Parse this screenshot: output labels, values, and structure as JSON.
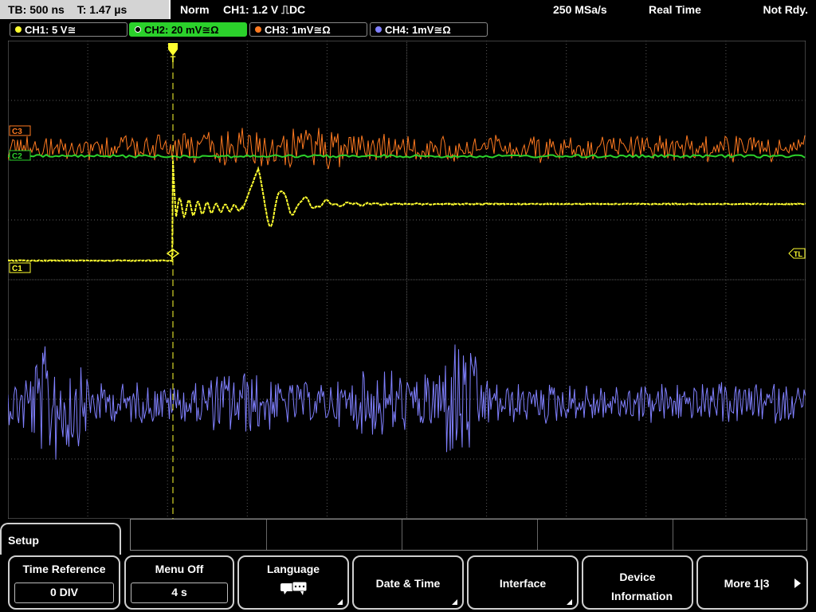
{
  "topbar": {
    "timebase": "TB: 500 ns",
    "trigger_time": "T: 1.47 µs",
    "trigger_mode": "Norm",
    "trigger_info": "CH1: 1.2 V ⎍DC",
    "sample_rate": "250 MSa/s",
    "acq_mode": "Real Time",
    "status": "Not Rdy."
  },
  "channels": [
    {
      "label": "CH1: 5 V≅",
      "color": "#ffff30"
    },
    {
      "label": "CH2: 20 mV≅Ω",
      "color": "#2bd12b"
    },
    {
      "label": "CH3: 1mV≅Ω",
      "color": "#ff7a20"
    },
    {
      "label": "CH4: 1mV≅Ω",
      "color": "#8080ff"
    }
  ],
  "markers": {
    "c1": "C1",
    "c3": "C3",
    "c2": "C2",
    "trigger_level": "TL",
    "trigger_pos": "T"
  },
  "colors": {
    "grid": "#5a5a5a",
    "ch1": "#ffff30",
    "ch2": "#2bd12b",
    "ch3": "#ff7a20",
    "ch4": "#8080ff"
  },
  "menu": {
    "title": "Setup",
    "softkeys": [
      {
        "label": "Time Reference",
        "value": "0 DIV"
      },
      {
        "label": "Menu Off",
        "value": "4 s"
      },
      {
        "label": "Language",
        "icon": "speech-bubbles-icon"
      },
      {
        "label": "Date & Time"
      },
      {
        "label": "Interface"
      },
      {
        "label": "Device Information"
      },
      {
        "label": "More 1|3"
      }
    ]
  }
}
